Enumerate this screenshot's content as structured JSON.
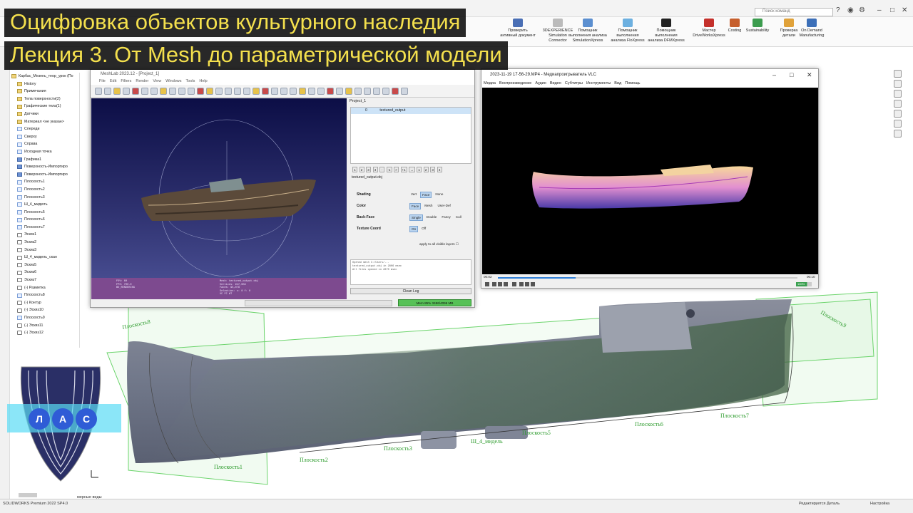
{
  "overlay": {
    "title": "Оцифровка объектов культурного наследия",
    "subtitle": "Лекция 3. От Mesh до параметрической модели"
  },
  "solidworks": {
    "search_placeholder": "Поиск команд",
    "ribbon": [
      {
        "label": "Проверить\nактивный документ",
        "color": "#4a6fb5"
      },
      {
        "label": "3DEXPERIENCE\nSimulation\nConnector",
        "color": "#bbbbbb"
      },
      {
        "label": "Помощник\nвыполнения анализа\nSimulationXpress",
        "color": "#5b8fd0"
      },
      {
        "label": "Помощник\nвыполнения\nанализа FloXpress",
        "color": "#6db0e0"
      },
      {
        "label": "Помощник\nвыполнения\nанализа DFMXpress",
        "color": "#222222"
      },
      {
        "label": "Мастер\nDriveWorksXpress",
        "color": "#c4302b"
      },
      {
        "label": "Costing",
        "color": "#c65f2d"
      },
      {
        "label": "Sustainability",
        "color": "#3c9c4e"
      },
      {
        "label": "Проверка\nдетали",
        "color": "#e0a23a"
      },
      {
        "label": "On Demand\nManufacturing",
        "color": "#3c6fb8"
      }
    ],
    "tree": [
      {
        "label": "Карбас_Мезень_теор_урок (По",
        "icon": "part"
      },
      {
        "label": "History",
        "icon": "folder"
      },
      {
        "label": "Примечания",
        "icon": "folder"
      },
      {
        "label": "Тела поверхности(2)",
        "icon": "folder"
      },
      {
        "label": "Графические тела(1)",
        "icon": "folder"
      },
      {
        "label": "Датчики",
        "icon": "folder"
      },
      {
        "label": "Материал <не указан>",
        "icon": "folder"
      },
      {
        "label": "Спереди",
        "icon": "plane"
      },
      {
        "label": "Сверху",
        "icon": "plane"
      },
      {
        "label": "Справа",
        "icon": "plane"
      },
      {
        "label": "Исходная точка",
        "icon": "plane"
      },
      {
        "label": "Графика1",
        "icon": "blue"
      },
      {
        "label": "Поверхность-Импортиро",
        "icon": "blue"
      },
      {
        "label": "Поверхность-Импортиро",
        "icon": "blue"
      },
      {
        "label": "Плоскость1",
        "icon": "plane"
      },
      {
        "label": "Плоскость2",
        "icon": "plane"
      },
      {
        "label": "Плоскость3",
        "icon": "plane"
      },
      {
        "label": "Ш_4_миделъ",
        "icon": "plane"
      },
      {
        "label": "Плоскость5",
        "icon": "plane"
      },
      {
        "label": "Плоскость6",
        "icon": "plane"
      },
      {
        "label": "Плоскость7",
        "icon": "plane"
      },
      {
        "label": "Эскиз1",
        "icon": "sketch"
      },
      {
        "label": "Эскиз2",
        "icon": "sketch"
      },
      {
        "label": "Эскиз3",
        "icon": "sketch"
      },
      {
        "label": "Ш_4_мидель_скан",
        "icon": "sketch"
      },
      {
        "label": "Эскиз5",
        "icon": "sketch"
      },
      {
        "label": "Эскиз6",
        "icon": "sketch"
      },
      {
        "label": "Эскиз7",
        "icon": "sketch"
      },
      {
        "label": "(-) Разметка",
        "icon": "sketch"
      },
      {
        "label": "Плоскость8",
        "icon": "plane"
      },
      {
        "label": "(-) Контур",
        "icon": "sketch"
      },
      {
        "label": "(-) Эскиз10",
        "icon": "sketch"
      },
      {
        "label": "Плоскость9",
        "icon": "plane"
      },
      {
        "label": "(-) Эскиз11",
        "icon": "sketch"
      },
      {
        "label": "(-) Эскиз12",
        "icon": "sketch"
      }
    ],
    "plane_labels": [
      "Плоскость8",
      "Плоскость1",
      "Плоскость2",
      "Плоскость3",
      "Ш_4_мидель",
      "Плоскость5",
      "Плоскость6",
      "Плоскость7",
      "Плоскость9"
    ],
    "status": {
      "left": "SOLIDWORKS Premium 2022 SP4.0",
      "middle": "Редактируется Деталь",
      "right": "Настройка"
    },
    "view_tab": "мерные виды"
  },
  "meshlab": {
    "title": "MeshLab 2023.12 - [Project_1]",
    "menu": [
      "File",
      "Edit",
      "Filters",
      "Render",
      "View",
      "Windows",
      "Tools",
      "Help"
    ],
    "panel_title": "Project_1",
    "layer_index": "0",
    "layer_name": "textured_output",
    "nums": [
      "1",
      "2",
      "3",
      "4",
      "-",
      "-1",
      ">",
      "+1",
      "→",
      "1",
      "2",
      "3",
      "4"
    ],
    "file_label": "textured_output.obj",
    "shading_label": "Shading",
    "shading_opts": [
      "Vert",
      "Face",
      "None"
    ],
    "color_label": "Color",
    "color_opts": [
      "Face",
      "Mesh",
      "User-Def"
    ],
    "backface_label": "Back-Face",
    "backface_opts": [
      "Single",
      "Double",
      "Fancy",
      "Cull"
    ],
    "texcoord_label": "Texture Coord",
    "texcoord_opts": [
      "On",
      "Off"
    ],
    "apply_label": "apply to all visible layers",
    "log_lines": [
      "Opened mesh C:/Users/...",
      "textured_output.obj in 2806 msec",
      "All files opened in 2870 msec"
    ],
    "clear_label": "Clean Log",
    "mem_label": "Mem 85% 3486/4096 MB",
    "info_left": [
      "FOV: 60",
      "FPS: 700.0",
      "BO_RENDERING"
    ],
    "info_right": [
      "Mesh: textured_output.obj",
      "Vertices: 947,958",
      "Faces: 95,078",
      "Selection: v: 0 f: 0",
      "VC FC WT"
    ]
  },
  "vlc": {
    "title": "2023-11-19 17-56-29.MP4 - Медиапроигрыватель VLC",
    "menu": [
      "Медиа",
      "Воспроизведение",
      "Аудио",
      "Видео",
      "Субтитры",
      "Инструменты",
      "Вид",
      "Помощь"
    ],
    "time_elapsed": "00:02",
    "time_total": "00:10",
    "progress": 0.26,
    "volume": "100%"
  },
  "logo": {
    "letters": [
      "Л",
      "А",
      "С"
    ]
  }
}
